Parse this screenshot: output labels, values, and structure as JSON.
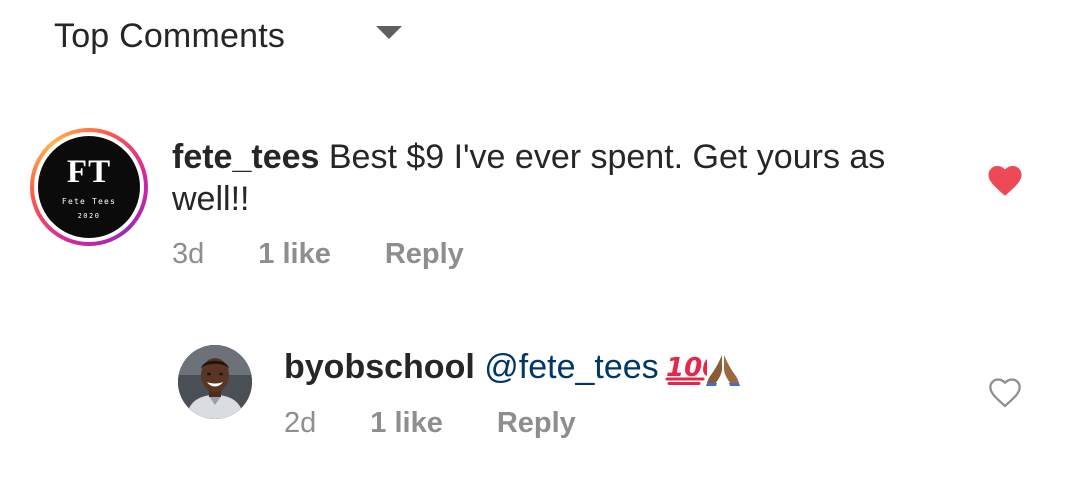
{
  "sort": {
    "label": "Top Comments",
    "icon": "chevron-down-icon"
  },
  "comments": [
    {
      "avatar": {
        "initials": "FT",
        "brand": "Fete Tees",
        "year": "2020",
        "story_ring": true
      },
      "username": "fete_tees",
      "text": " Best $9 I've ever spent. Get yours as well!!",
      "age": "3d",
      "likes": "1 like",
      "reply_label": "Reply",
      "liked": true,
      "heart_color": "#ed4956"
    },
    {
      "username": "byobschool",
      "mention": "@fete_tees",
      "emojis": [
        "hundred-points-emoji",
        "folded-hands-emoji"
      ],
      "age": "2d",
      "likes": "1 like",
      "reply_label": "Reply",
      "liked": false,
      "mention_color": "#00376b"
    }
  ]
}
